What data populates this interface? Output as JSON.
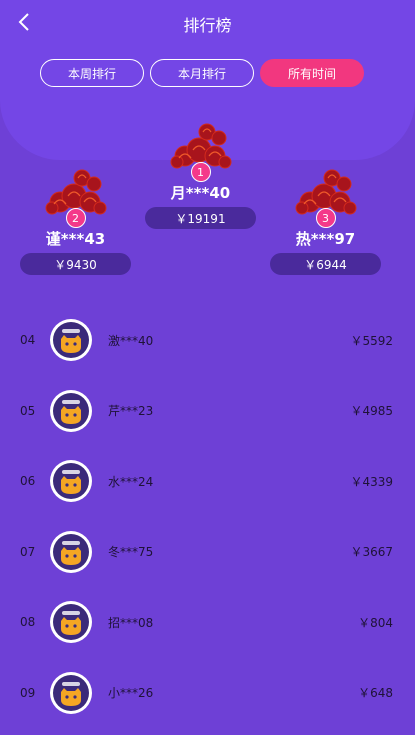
{
  "header": {
    "title": "排行榜"
  },
  "tabs": [
    {
      "label": "本周排行",
      "active": false
    },
    {
      "label": "本月排行",
      "active": false
    },
    {
      "label": "所有时间",
      "active": true
    }
  ],
  "podium": [
    {
      "rank": "1",
      "name": "月***40",
      "amount": "￥19191"
    },
    {
      "rank": "2",
      "name": "谨***43",
      "amount": "￥9430"
    },
    {
      "rank": "3",
      "name": "热***97",
      "amount": "￥6944"
    }
  ],
  "ranking": [
    {
      "rank": "04",
      "name": "激***40",
      "amount": "￥5592"
    },
    {
      "rank": "05",
      "name": "芹***23",
      "amount": "￥4985"
    },
    {
      "rank": "06",
      "name": "水***24",
      "amount": "￥4339"
    },
    {
      "rank": "07",
      "name": "冬***75",
      "amount": "￥3667"
    },
    {
      "rank": "08",
      "name": "招***08",
      "amount": "￥804"
    },
    {
      "rank": "09",
      "name": "小***26",
      "amount": "￥648"
    }
  ],
  "colors": {
    "background": "#6e40d6",
    "accent": "#f2377f",
    "cloud": "#b5141c"
  }
}
